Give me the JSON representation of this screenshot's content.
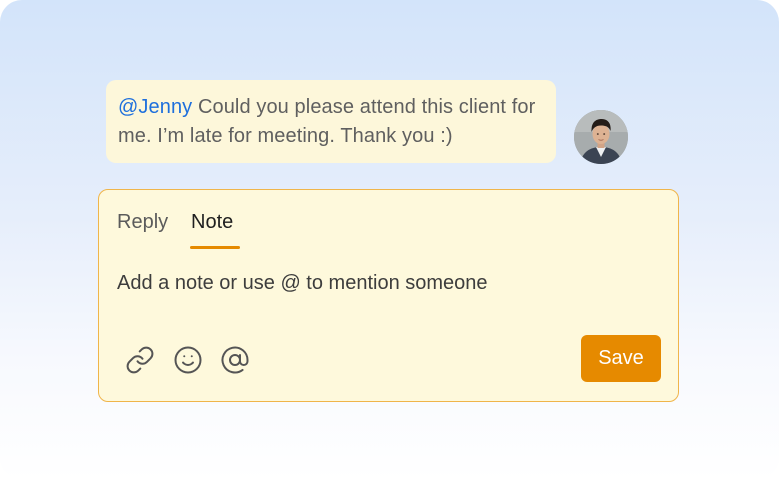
{
  "message": {
    "mention": "@Jenny",
    "text": " Could you please attend this client for me. I’m late for meeting. Thank you :)"
  },
  "composer": {
    "tabs": [
      {
        "label": "Reply",
        "active": false
      },
      {
        "label": "Note",
        "active": true
      }
    ],
    "placeholder": "Add a note or use @ to mention someone",
    "value": "",
    "toolbar_icons": [
      "link-icon",
      "emoji-icon",
      "at-mention-icon"
    ],
    "save_label": "Save"
  },
  "colors": {
    "accent": "#e68a00",
    "mention": "#1e6fdc",
    "note_background": "#fef9dc",
    "note_border": "#f0b54a",
    "bubble_background": "#fdf7da"
  }
}
